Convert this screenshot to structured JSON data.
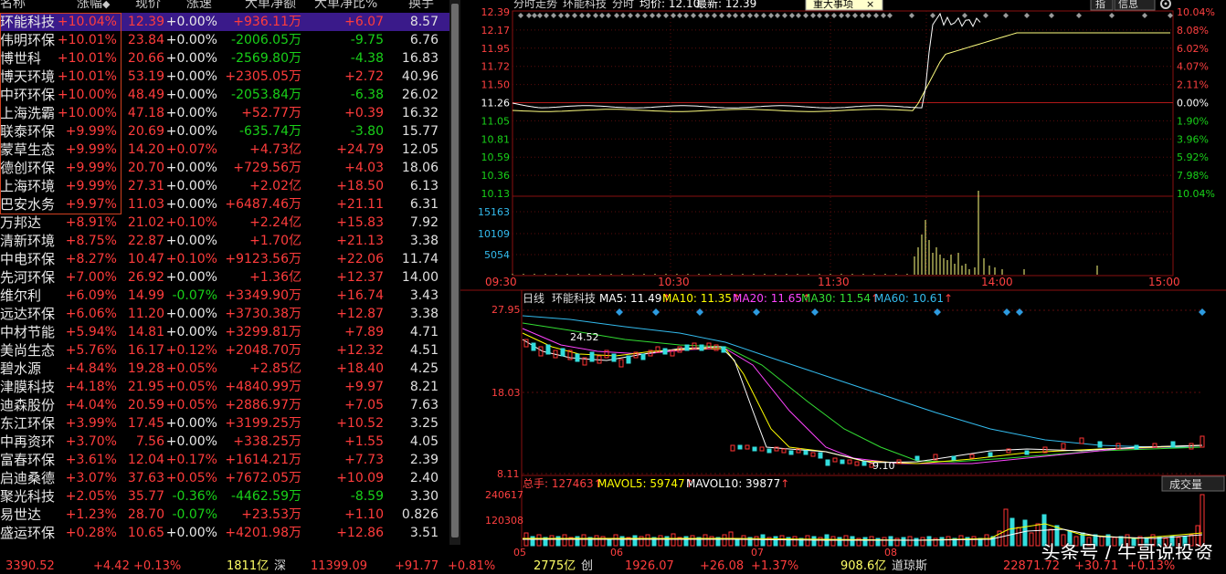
{
  "table": {
    "headers": {
      "name": "名称",
      "change": "涨幅",
      "price": "现价",
      "speed": "涨速",
      "amount": "大单净额",
      "ratio": "大单净比%",
      "turnover": "换手"
    },
    "rows": [
      {
        "name": "环能科技",
        "change": "+10.04%",
        "price": "12.39",
        "speed": "+0.00%",
        "amount": "+936.11",
        "unit": "万",
        "ratio": "+6.07",
        "turnover": "8.57"
      },
      {
        "name": "伟明环保",
        "change": "+10.01%",
        "price": "23.84",
        "speed": "+0.00%",
        "amount": "-2006.05",
        "unit": "万",
        "ratio": "-9.75",
        "turnover": "6.76"
      },
      {
        "name": "博世科",
        "change": "+10.01%",
        "price": "20.66",
        "speed": "+0.00%",
        "amount": "-2569.80",
        "unit": "万",
        "ratio": "-4.38",
        "turnover": "16.83"
      },
      {
        "name": "博天环境",
        "change": "+10.01%",
        "price": "53.19",
        "speed": "+0.00%",
        "amount": "+2305.05",
        "unit": "万",
        "ratio": "+2.72",
        "turnover": "40.96"
      },
      {
        "name": "中环环保",
        "change": "+10.00%",
        "price": "48.49",
        "speed": "+0.00%",
        "amount": "-2053.84",
        "unit": "万",
        "ratio": "-6.38",
        "turnover": "26.02"
      },
      {
        "name": "上海洗霸",
        "change": "+10.00%",
        "price": "47.18",
        "speed": "+0.00%",
        "amount": "+52.77",
        "unit": "万",
        "ratio": "+0.39",
        "turnover": "16.32"
      },
      {
        "name": "联泰环保",
        "change": "+9.99%",
        "price": "20.69",
        "speed": "+0.00%",
        "amount": "-635.74",
        "unit": "万",
        "ratio": "-3.80",
        "turnover": "15.77"
      },
      {
        "name": "蒙草生态",
        "change": "+9.99%",
        "price": "14.20",
        "speed": "+0.07%",
        "amount": "+4.73",
        "unit": "亿",
        "ratio": "+24.79",
        "turnover": "12.05"
      },
      {
        "name": "德创环保",
        "change": "+9.99%",
        "price": "20.70",
        "speed": "+0.00%",
        "amount": "+729.56",
        "unit": "万",
        "ratio": "+4.03",
        "turnover": "18.06"
      },
      {
        "name": "上海环境",
        "change": "+9.99%",
        "price": "27.31",
        "speed": "+0.00%",
        "amount": "+2.02",
        "unit": "亿",
        "ratio": "+18.50",
        "turnover": "6.13"
      },
      {
        "name": "巴安水务",
        "change": "+9.97%",
        "price": "11.03",
        "speed": "+0.00%",
        "amount": "+6487.46",
        "unit": "万",
        "ratio": "+21.11",
        "turnover": "6.31"
      },
      {
        "name": "万邦达",
        "change": "+8.91%",
        "price": "21.02",
        "speed": "+0.10%",
        "amount": "+2.24",
        "unit": "亿",
        "ratio": "+15.83",
        "turnover": "7.92"
      },
      {
        "name": "清新环境",
        "change": "+8.75%",
        "price": "22.87",
        "speed": "+0.00%",
        "amount": "+1.70",
        "unit": "亿",
        "ratio": "+21.13",
        "turnover": "3.38"
      },
      {
        "name": "中电环保",
        "change": "+8.27%",
        "price": "10.47",
        "speed": "+0.10%",
        "amount": "+9123.56",
        "unit": "万",
        "ratio": "+22.06",
        "turnover": "11.74"
      },
      {
        "name": "先河环保",
        "change": "+7.00%",
        "price": "26.92",
        "speed": "+0.00%",
        "amount": "+1.36",
        "unit": "亿",
        "ratio": "+12.37",
        "turnover": "14.00"
      },
      {
        "name": "维尔利",
        "change": "+6.09%",
        "price": "14.99",
        "speed": "-0.07%",
        "amount": "+3349.90",
        "unit": "万",
        "ratio": "+16.74",
        "turnover": "3.43"
      },
      {
        "name": "远达环保",
        "change": "+6.06%",
        "price": "11.20",
        "speed": "+0.00%",
        "amount": "+3730.38",
        "unit": "万",
        "ratio": "+12.87",
        "turnover": "3.38"
      },
      {
        "name": "中材节能",
        "change": "+5.94%",
        "price": "14.81",
        "speed": "+0.00%",
        "amount": "+3299.81",
        "unit": "万",
        "ratio": "+7.89",
        "turnover": "4.71"
      },
      {
        "name": "美尚生态",
        "change": "+5.76%",
        "price": "16.17",
        "speed": "+0.12%",
        "amount": "+2048.70",
        "unit": "万",
        "ratio": "+12.32",
        "turnover": "4.51"
      },
      {
        "name": "碧水源",
        "change": "+4.84%",
        "price": "19.28",
        "speed": "+0.05%",
        "amount": "+2.85",
        "unit": "亿",
        "ratio": "+18.40",
        "turnover": "4.25"
      },
      {
        "name": "津膜科技",
        "change": "+4.18%",
        "price": "21.95",
        "speed": "+0.05%",
        "amount": "+4840.99",
        "unit": "万",
        "ratio": "+9.97",
        "turnover": "8.21"
      },
      {
        "name": "迪森股份",
        "change": "+4.04%",
        "price": "20.59",
        "speed": "+0.05%",
        "amount": "+2886.97",
        "unit": "万",
        "ratio": "+7.05",
        "turnover": "7.63"
      },
      {
        "name": "东江环保",
        "change": "+3.99%",
        "price": "17.45",
        "speed": "+0.00%",
        "amount": "+3199.25",
        "unit": "万",
        "ratio": "+10.52",
        "turnover": "3.25"
      },
      {
        "name": "中再资环",
        "change": "+3.70%",
        "price": "7.56",
        "speed": "+0.00%",
        "amount": "+338.25",
        "unit": "万",
        "ratio": "+1.55",
        "turnover": "4.05"
      },
      {
        "name": "富春环保",
        "change": "+3.61%",
        "price": "12.04",
        "speed": "+0.17%",
        "amount": "+1614.21",
        "unit": "万",
        "ratio": "+7.73",
        "turnover": "2.39"
      },
      {
        "name": "启迪桑德",
        "change": "+3.07%",
        "price": "37.63",
        "speed": "+0.05%",
        "amount": "+7672.05",
        "unit": "万",
        "ratio": "+10.09",
        "turnover": "2.40"
      },
      {
        "name": "聚光科技",
        "change": "+2.05%",
        "price": "35.77",
        "speed": "-0.36%",
        "amount": "-4462.59",
        "unit": "万",
        "ratio": "-8.59",
        "turnover": "3.30"
      },
      {
        "name": "易世达",
        "change": "+1.23%",
        "price": "28.70",
        "speed": "-0.07%",
        "amount": "+23.53",
        "unit": "万",
        "ratio": "+1.10",
        "turnover": "0.826"
      },
      {
        "name": "盛运环保",
        "change": "+0.28%",
        "price": "10.65",
        "speed": "+0.00%",
        "amount": "+4201.98",
        "unit": "万",
        "ratio": "+12.86",
        "turnover": "3.51"
      }
    ]
  },
  "status_bar": {
    "sh_index": "3390.52",
    "sh_change": "+4.42",
    "sh_pct": "+0.13%",
    "sh_amount": "1811亿",
    "sz_label": "深",
    "sz_index": "11399.09",
    "sz_change": "+91.77",
    "sz_pct": "+0.81%",
    "sz_amount": "2775亿",
    "cy_label": "创",
    "cy_index": "1926.07",
    "cy_change": "+26.08",
    "cy_pct": "+1.37%",
    "other_amount": "908.6亿",
    "dq_label": "道琼斯",
    "dj_index": "22871.72",
    "dj_change": "+30.71",
    "dj_pct": "+0.13%"
  },
  "intraday": {
    "title": "分时走势",
    "stock": "环能科技",
    "time_label": "分时",
    "avg_label": "均价: 12.10",
    "latest_label": "最新: 12.39",
    "event_button": "重大事项",
    "event_close": "×",
    "tab_index": "指",
    "tab_info": "信息",
    "settings_icon": "gear-icon",
    "price_ticks": [
      "12.39",
      "12.17",
      "11.95",
      "11.72",
      "11.50",
      "11.26",
      "11.05",
      "10.81",
      "10.59",
      "10.36",
      "10.13"
    ],
    "pct_ticks": [
      "10.04%",
      "8.08%",
      "6.02%",
      "4.07%",
      "2.11%",
      "0.00%",
      "1.90%",
      "3.96%",
      "5.92%",
      "7.98%",
      "10.04%"
    ],
    "vol_ticks": [
      "15163",
      "10109",
      "5054"
    ],
    "time_ticks": [
      "09:30",
      "10:30",
      "11:30",
      "14:00",
      "15:00"
    ]
  },
  "daily": {
    "label": "日线",
    "stock": "环能科技",
    "ma5": "MA5: 11.49",
    "ma10": "MA10: 11.35",
    "ma20": "MA20: 11.65",
    "ma30": "MA30: 11.54",
    "ma60": "MA60: 10.61",
    "arrow": "↑",
    "price_ticks": [
      "27.95",
      "18.03",
      "8.11"
    ],
    "high_label": "24.52",
    "low_label": "9.10",
    "colors": {
      "ma5": "#ffffff",
      "ma10": "#ffff00",
      "ma20": "#ff44ff",
      "ma30": "#33dd33",
      "ma60": "#33bbee",
      "up": "#ff3333",
      "down": "#33dddd"
    }
  },
  "volume": {
    "total": "总手: 127463",
    "mavol5": "MAVOL5: 59747",
    "mavol10": "MAVOL10: 39877",
    "arrow": "↑",
    "dropdown": "成交量",
    "ticks": [
      "240617",
      "120308"
    ],
    "months": [
      "05",
      "06",
      "07",
      "08"
    ]
  },
  "watermark": "头条号 / 牛哥说投资"
}
